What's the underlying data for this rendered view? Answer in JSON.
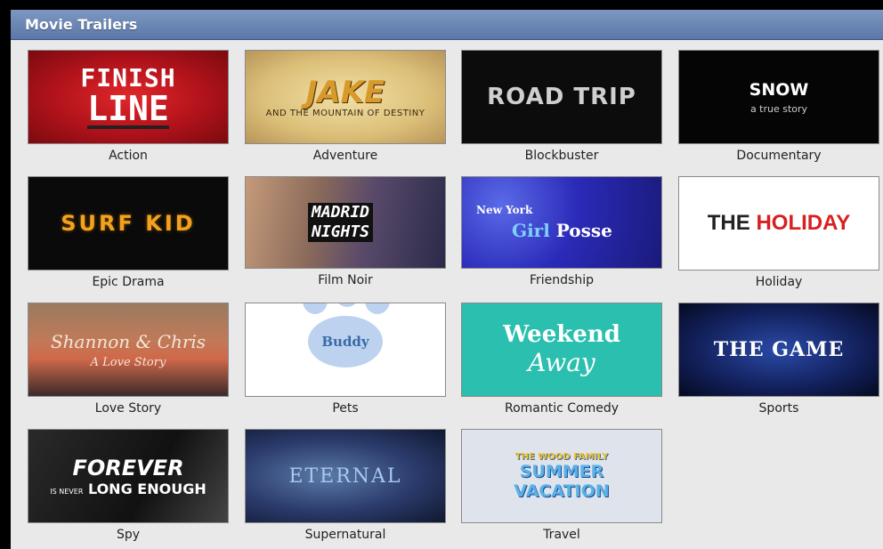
{
  "header": {
    "title": "Movie Trailers"
  },
  "trailers": [
    {
      "caption": "Action",
      "line1": "FINISH",
      "line2": "LINE"
    },
    {
      "caption": "Adventure",
      "line1": "JAKE",
      "line2": "AND THE MOUNTAIN OF DESTINY"
    },
    {
      "caption": "Blockbuster",
      "line1": "ROAD TRIP"
    },
    {
      "caption": "Documentary",
      "line1": "SNOW",
      "line2": "a true story"
    },
    {
      "caption": "Epic Drama",
      "line1": "SURF KID"
    },
    {
      "caption": "Film Noir",
      "line1": "MADRID",
      "line2": "NIGHTS"
    },
    {
      "caption": "Friendship",
      "line1": "New York",
      "line2a": "Girl",
      "line2b": "Posse"
    },
    {
      "caption": "Holiday",
      "line1a": "THE",
      "line1b": "HOLIDAY"
    },
    {
      "caption": "Love Story",
      "line1": "Shannon & Chris",
      "line2": "A Love Story"
    },
    {
      "caption": "Pets",
      "line1": "Buddy"
    },
    {
      "caption": "Romantic Comedy",
      "line1": "Weekend",
      "line2": "Away"
    },
    {
      "caption": "Sports",
      "line1": "THE GAME"
    },
    {
      "caption": "Spy",
      "line1": "FOREVER",
      "line2a": "IS NEVER",
      "line2b": "LONG ENOUGH"
    },
    {
      "caption": "Supernatural",
      "line1": "ETERNAL"
    },
    {
      "caption": "Travel",
      "line1": "THE WOOD FAMILY",
      "line2": "SUMMER VACATION"
    }
  ]
}
